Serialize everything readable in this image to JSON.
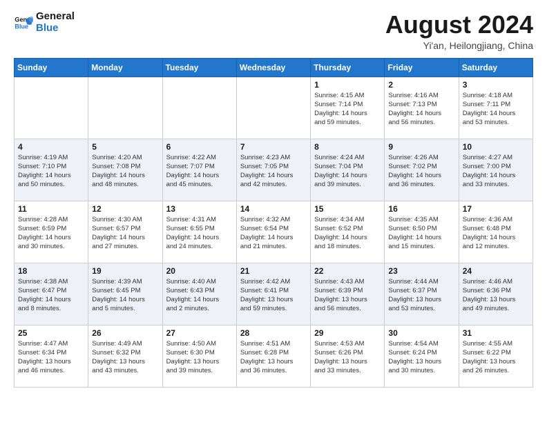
{
  "logo": {
    "text_general": "General",
    "text_blue": "Blue"
  },
  "title": "August 2024",
  "subtitle": "Yi'an, Heilongjiang, China",
  "days_of_week": [
    "Sunday",
    "Monday",
    "Tuesday",
    "Wednesday",
    "Thursday",
    "Friday",
    "Saturday"
  ],
  "weeks": [
    [
      {
        "day": "",
        "info": ""
      },
      {
        "day": "",
        "info": ""
      },
      {
        "day": "",
        "info": ""
      },
      {
        "day": "",
        "info": ""
      },
      {
        "day": "1",
        "info": "Sunrise: 4:15 AM\nSunset: 7:14 PM\nDaylight: 14 hours\nand 59 minutes."
      },
      {
        "day": "2",
        "info": "Sunrise: 4:16 AM\nSunset: 7:13 PM\nDaylight: 14 hours\nand 56 minutes."
      },
      {
        "day": "3",
        "info": "Sunrise: 4:18 AM\nSunset: 7:11 PM\nDaylight: 14 hours\nand 53 minutes."
      }
    ],
    [
      {
        "day": "4",
        "info": "Sunrise: 4:19 AM\nSunset: 7:10 PM\nDaylight: 14 hours\nand 50 minutes."
      },
      {
        "day": "5",
        "info": "Sunrise: 4:20 AM\nSunset: 7:08 PM\nDaylight: 14 hours\nand 48 minutes."
      },
      {
        "day": "6",
        "info": "Sunrise: 4:22 AM\nSunset: 7:07 PM\nDaylight: 14 hours\nand 45 minutes."
      },
      {
        "day": "7",
        "info": "Sunrise: 4:23 AM\nSunset: 7:05 PM\nDaylight: 14 hours\nand 42 minutes."
      },
      {
        "day": "8",
        "info": "Sunrise: 4:24 AM\nSunset: 7:04 PM\nDaylight: 14 hours\nand 39 minutes."
      },
      {
        "day": "9",
        "info": "Sunrise: 4:26 AM\nSunset: 7:02 PM\nDaylight: 14 hours\nand 36 minutes."
      },
      {
        "day": "10",
        "info": "Sunrise: 4:27 AM\nSunset: 7:00 PM\nDaylight: 14 hours\nand 33 minutes."
      }
    ],
    [
      {
        "day": "11",
        "info": "Sunrise: 4:28 AM\nSunset: 6:59 PM\nDaylight: 14 hours\nand 30 minutes."
      },
      {
        "day": "12",
        "info": "Sunrise: 4:30 AM\nSunset: 6:57 PM\nDaylight: 14 hours\nand 27 minutes."
      },
      {
        "day": "13",
        "info": "Sunrise: 4:31 AM\nSunset: 6:55 PM\nDaylight: 14 hours\nand 24 minutes."
      },
      {
        "day": "14",
        "info": "Sunrise: 4:32 AM\nSunset: 6:54 PM\nDaylight: 14 hours\nand 21 minutes."
      },
      {
        "day": "15",
        "info": "Sunrise: 4:34 AM\nSunset: 6:52 PM\nDaylight: 14 hours\nand 18 minutes."
      },
      {
        "day": "16",
        "info": "Sunrise: 4:35 AM\nSunset: 6:50 PM\nDaylight: 14 hours\nand 15 minutes."
      },
      {
        "day": "17",
        "info": "Sunrise: 4:36 AM\nSunset: 6:48 PM\nDaylight: 14 hours\nand 12 minutes."
      }
    ],
    [
      {
        "day": "18",
        "info": "Sunrise: 4:38 AM\nSunset: 6:47 PM\nDaylight: 14 hours\nand 8 minutes."
      },
      {
        "day": "19",
        "info": "Sunrise: 4:39 AM\nSunset: 6:45 PM\nDaylight: 14 hours\nand 5 minutes."
      },
      {
        "day": "20",
        "info": "Sunrise: 4:40 AM\nSunset: 6:43 PM\nDaylight: 14 hours\nand 2 minutes."
      },
      {
        "day": "21",
        "info": "Sunrise: 4:42 AM\nSunset: 6:41 PM\nDaylight: 13 hours\nand 59 minutes."
      },
      {
        "day": "22",
        "info": "Sunrise: 4:43 AM\nSunset: 6:39 PM\nDaylight: 13 hours\nand 56 minutes."
      },
      {
        "day": "23",
        "info": "Sunrise: 4:44 AM\nSunset: 6:37 PM\nDaylight: 13 hours\nand 53 minutes."
      },
      {
        "day": "24",
        "info": "Sunrise: 4:46 AM\nSunset: 6:36 PM\nDaylight: 13 hours\nand 49 minutes."
      }
    ],
    [
      {
        "day": "25",
        "info": "Sunrise: 4:47 AM\nSunset: 6:34 PM\nDaylight: 13 hours\nand 46 minutes."
      },
      {
        "day": "26",
        "info": "Sunrise: 4:49 AM\nSunset: 6:32 PM\nDaylight: 13 hours\nand 43 minutes."
      },
      {
        "day": "27",
        "info": "Sunrise: 4:50 AM\nSunset: 6:30 PM\nDaylight: 13 hours\nand 39 minutes."
      },
      {
        "day": "28",
        "info": "Sunrise: 4:51 AM\nSunset: 6:28 PM\nDaylight: 13 hours\nand 36 minutes."
      },
      {
        "day": "29",
        "info": "Sunrise: 4:53 AM\nSunset: 6:26 PM\nDaylight: 13 hours\nand 33 minutes."
      },
      {
        "day": "30",
        "info": "Sunrise: 4:54 AM\nSunset: 6:24 PM\nDaylight: 13 hours\nand 30 minutes."
      },
      {
        "day": "31",
        "info": "Sunrise: 4:55 AM\nSunset: 6:22 PM\nDaylight: 13 hours\nand 26 minutes."
      }
    ]
  ]
}
